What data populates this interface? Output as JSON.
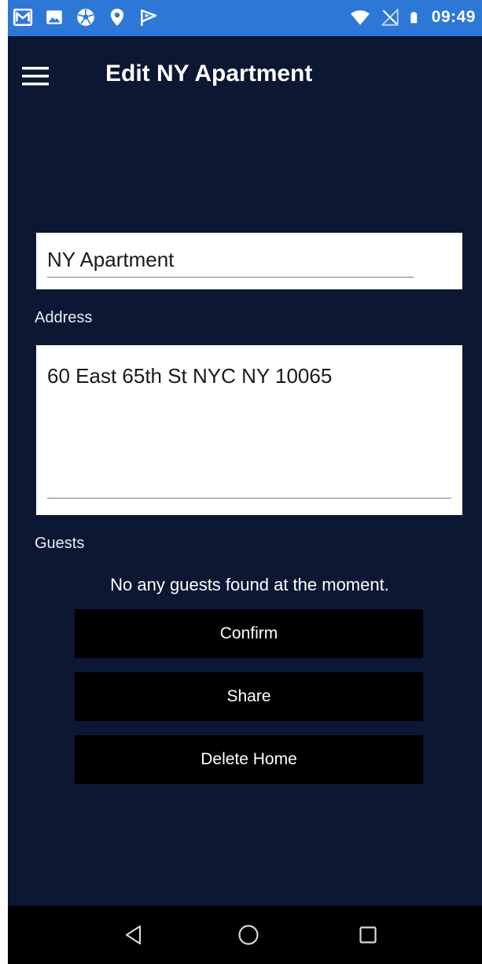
{
  "status_bar": {
    "time": "09:49",
    "left_icons": [
      "gmail-icon",
      "photo-icon",
      "soccer-ball-icon",
      "location-pin-icon",
      "flag-icon"
    ],
    "right_icons": [
      "wifi-icon",
      "no-signal-icon",
      "battery-icon"
    ]
  },
  "app_bar": {
    "menu_icon": "menu-icon",
    "title": "Edit NY Apartment"
  },
  "form": {
    "name_value": "NY Apartment",
    "address_label": "Address",
    "address_value": "60 East 65th St NYC NY 10065",
    "guests_label": "Guests",
    "guests_empty_text": "No any guests found at the moment."
  },
  "actions": {
    "confirm": "Confirm",
    "share": "Share",
    "delete": "Delete Home"
  },
  "nav_bar": {
    "icons": [
      "back-triangle-icon",
      "home-circle-icon",
      "recents-square-icon"
    ]
  },
  "colors": {
    "background": "#0b1733",
    "status_bar": "#2d78d6",
    "button": "#000000",
    "field": "#ffffff"
  }
}
